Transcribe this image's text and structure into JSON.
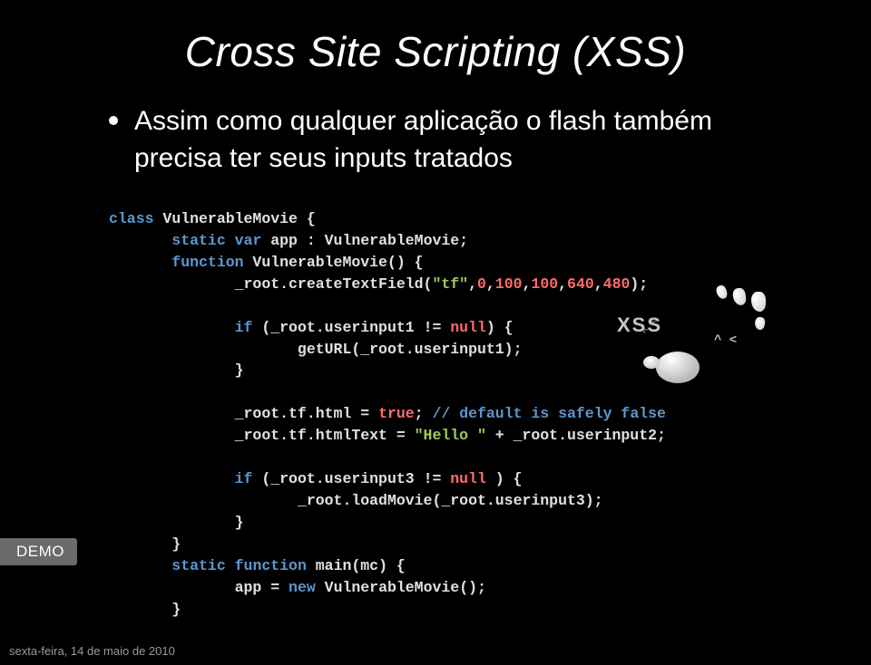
{
  "title": "Cross Site Scripting (XSS)",
  "bullet": "Assim como qualquer aplicação o flash também precisa ter seus inputs tratados",
  "code": {
    "l1a": "class",
    "l1b": " VulnerableMovie {",
    "l2a": "       static",
    "l2b": " var",
    "l2c": " app : VulnerableMovie;",
    "l3a": "       function",
    "l3b": " VulnerableMovie() {",
    "l4a": "              _root.createTextField(",
    "l4b": "\"tf\"",
    "l4c": ",",
    "l4d": "0",
    "l4e": ",",
    "l4f": "100",
    "l4g": ",",
    "l4h": "100",
    "l4i": ",",
    "l4j": "640",
    "l4k": ",",
    "l4l": "480",
    "l4m": ");",
    "l5": " ",
    "l6a": "              if",
    "l6b": " (_root.userinput1 != ",
    "l6c": "null",
    "l6d": ") {",
    "l7": "                     getURL(_root.userinput1);",
    "l8": "              }",
    "l9": " ",
    "l10a": "              _root.tf.html = ",
    "l10b": "true",
    "l10c": "; ",
    "l10d": "// default is safely false",
    "l11a": "              _root.tf.htmlText = ",
    "l11b": "\"Hello \"",
    "l11c": " + _root.userinput2;",
    "l12": " ",
    "l13a": "              if",
    "l13b": " (_root.userinput3 != ",
    "l13c": "null",
    "l13d": " ) {",
    "l14": "                     _root.loadMovie(_root.userinput3);",
    "l15": "              }",
    "l16": "       }",
    "l17a": "       static",
    "l17b": " function",
    "l17c": " main(mc) {",
    "l18a": "              app = ",
    "l18b": "new",
    "l18c": " VulnerableMovie();",
    "l19": "       }"
  },
  "xss_label": "XSS",
  "face_text": "^ <",
  "demo_label": "DEMO",
  "footer": "sexta-feira, 14 de maio de 2010"
}
